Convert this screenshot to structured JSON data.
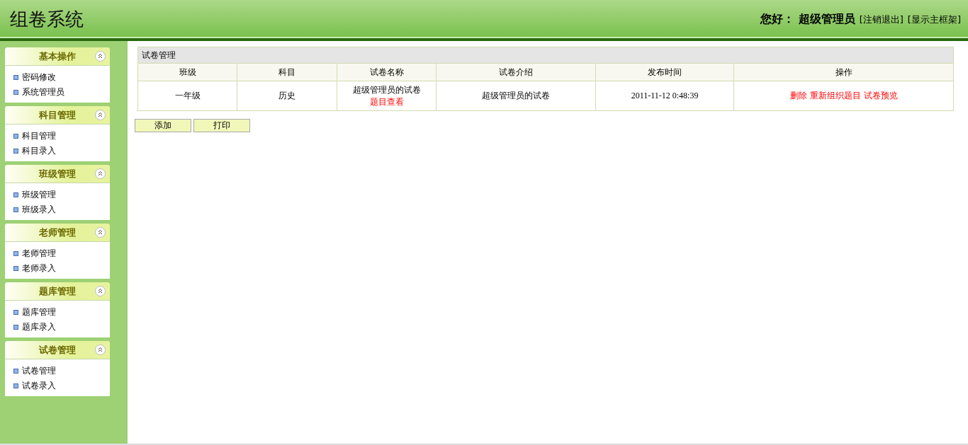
{
  "header": {
    "title": "组卷系统",
    "greeting": "您好：",
    "user": "超级管理员",
    "links": [
      "[注销退出]",
      "[显示主框架]"
    ]
  },
  "sidebar": {
    "groups": [
      {
        "title": "基本操作",
        "items": [
          "密码修改",
          "系统管理员"
        ]
      },
      {
        "title": "科目管理",
        "items": [
          "科目管理",
          "科目录入"
        ]
      },
      {
        "title": "班级管理",
        "items": [
          "班级管理",
          "班级录入"
        ]
      },
      {
        "title": "老师管理",
        "items": [
          "老师管理",
          "老师录入"
        ]
      },
      {
        "title": "题库管理",
        "items": [
          "题库管理",
          "题库录入"
        ]
      },
      {
        "title": "试卷管理",
        "items": [
          "试卷管理",
          "试卷录入"
        ]
      }
    ]
  },
  "table": {
    "title": "试卷管理",
    "columns": [
      "班级",
      "科目",
      "试卷名称",
      "试卷介绍",
      "发布时间",
      "操作"
    ],
    "rows": [
      {
        "class": "一年级",
        "subject": "历史",
        "name": "超级管理员的试卷",
        "name_link": "题目查看",
        "intro": "超级管理员的试卷",
        "time": "2011-11-12 0:48:39",
        "actions": [
          "删除",
          "重新组织题目",
          "试卷预览"
        ]
      }
    ]
  },
  "buttons": [
    "添加",
    "打印"
  ]
}
